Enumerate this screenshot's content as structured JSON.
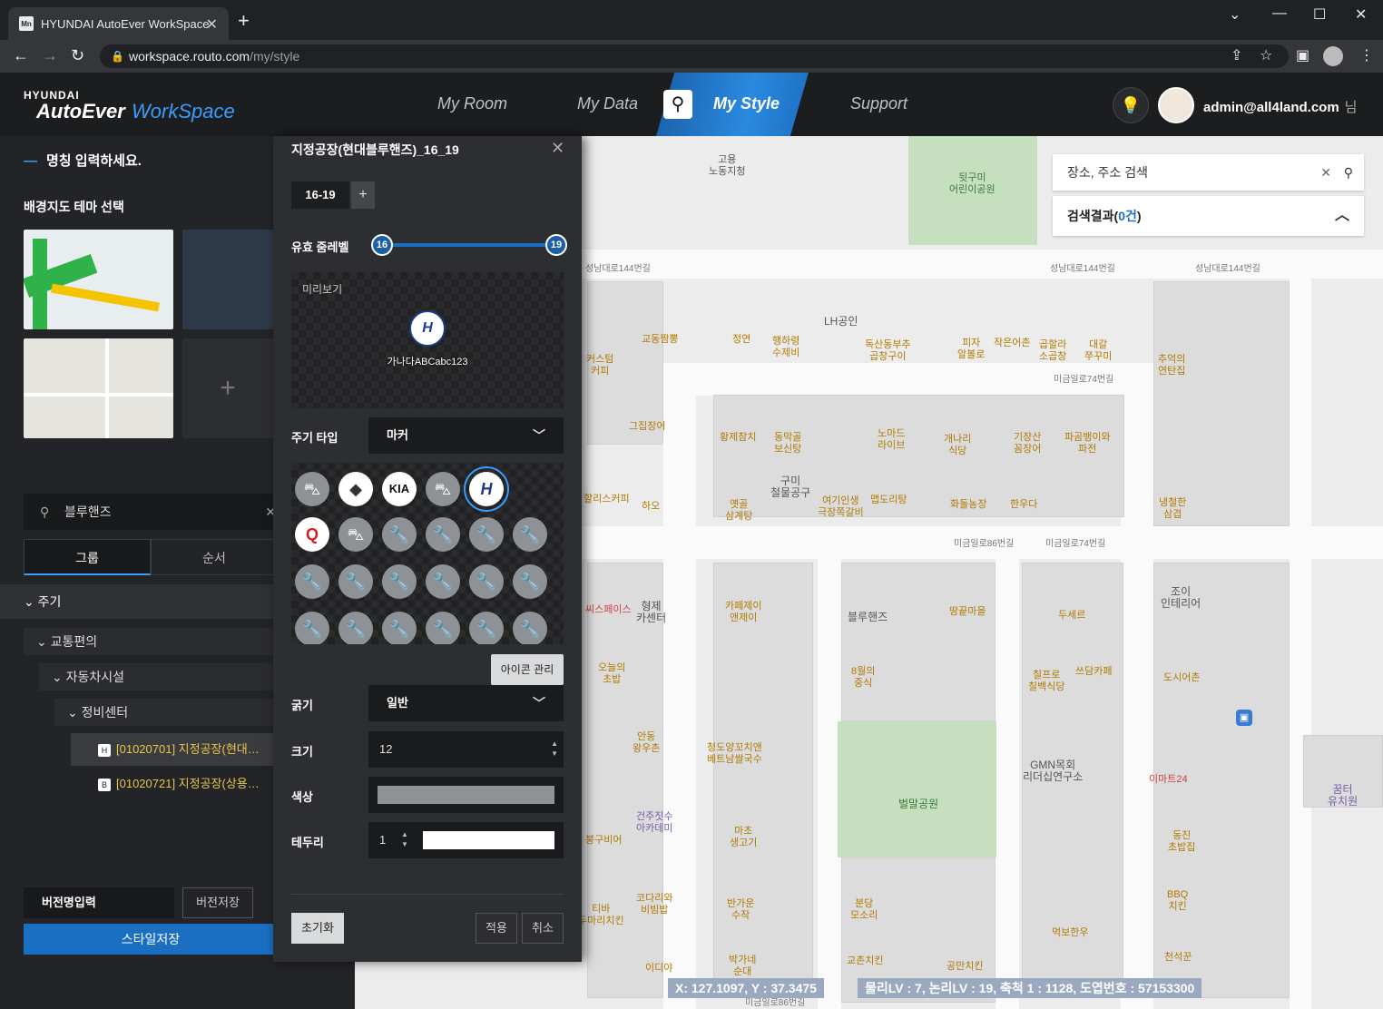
{
  "browser": {
    "tab_title": "HYUNDAI AutoEver WorkSpace",
    "favicon": "Mn",
    "url_host": "workspace.routo.com",
    "url_path": "/my/style"
  },
  "app": {
    "logo_top": "HYUNDAI",
    "logo_main": "AutoEver",
    "logo_sub": "WorkSpace",
    "menu": [
      "My Room",
      "My Data",
      "My Style",
      "Support"
    ],
    "active_menu": "My Style",
    "user": "admin@all4land.com",
    "user_suffix": "님"
  },
  "left": {
    "name_placeholder": "명칭 입력하세요.",
    "theme_title": "배경지도 테마 선택",
    "search_value": "블루핸즈",
    "tab_group": "그룹",
    "tab_order": "순서",
    "tree_root": "주기",
    "tree": [
      {
        "label": "교통편의"
      },
      {
        "label": "자동차시설"
      },
      {
        "label": "정비센터"
      }
    ],
    "tree_items": [
      "[01020701] 지정공장(현대…",
      "[01020721] 지정공장(상용…"
    ],
    "version_input": "버전명입력",
    "version_save": "버전저장",
    "style_save": "스타일저장"
  },
  "popup": {
    "title": "지정공장(현대블루핸즈)_16_19",
    "tab": "16-19",
    "zoom_label": "유효 줌레벨",
    "zoom_min": "16",
    "zoom_max": "19",
    "preview_label": "미리보기",
    "preview_text": "가나다ABCabc123",
    "type_label": "주기 타입",
    "type_value": "마커",
    "icon_manage": "아이콘 관리",
    "weight_label": "굵기",
    "weight_value": "일반",
    "size_label": "크기",
    "size_value": "12",
    "color_label": "색상",
    "color_value": "#8e9196",
    "border_label": "테두리",
    "border_value": "1",
    "reset": "초기화",
    "apply": "적용",
    "cancel": "취소"
  },
  "map": {
    "search_placeholder": "장소, 주소 검색",
    "result_prefix": "검색결과(",
    "result_count": "0건",
    "result_suffix": ")",
    "labels": {
      "l1": "고용\n노동지청",
      "l2": "뒷구미\n어린이공원",
      "l3": "LH공인",
      "l4": "교동짬뽕",
      "l5": "정연",
      "l6": "행하령\n수제비",
      "l7": "독산동부추\n곱창구이",
      "l8": "피자\n알볼로",
      "l9": "작은어촌",
      "l10": "곱할라\n소곱창",
      "l11": "대갈\n쭈꾸미",
      "l12": "추억의\n연탄집",
      "l13": "커스텀\n커피",
      "l14": "그집장어",
      "l15": "황제참치",
      "l16": "동막골\n보신탕",
      "l17": "노마드\n라이브",
      "l18": "개나리\n식당",
      "l19": "기장산\n꼼장어",
      "l20": "파곰뱅이와\n파전",
      "l21": "할리스커피",
      "l22": "하오",
      "l23": "옛골\n삼계탕",
      "l24": "구미\n철물공구",
      "l25": "여기인생\n극장쪽갈비",
      "l26": "맵도리탕",
      "l27": "화돌농장",
      "l28": "한우다",
      "l29": "냉철한\n삼겹",
      "l30": "씨스페이스",
      "l31": "형제\n카센터",
      "l32": "카페제이\n앤제이",
      "l33": "블루핸즈",
      "l34": "땅끝마을",
      "l35": "두세르",
      "l36": "조이\n인테리어",
      "l37": "오늘의\n초밥",
      "l38": "8월의\n중식",
      "l39": "칠프로\n칠백식당",
      "l40": "쓰담카페",
      "l41": "도시어촌",
      "l42": "안동\n왕우촌",
      "l43": "청도양꼬치앤\n베트남쌀국수",
      "l44": "GMN목회\n리더십연구소",
      "l45": "이마트24",
      "l46": "벌말공원",
      "l47": "붕구비어",
      "l48": "건주짓수\n아카데미",
      "l49": "마초\n생고기",
      "l50": "동진\n초밥집",
      "l51": "꿈터\n유치원",
      "l52": "티바\n두마리치킨",
      "l53": "코다리와\n비빔밥",
      "l54": "반가운\n수작",
      "l55": "분당\n모소리",
      "l56": "BBQ\n치킨",
      "l57": "먹보한우",
      "l58": "천석꾼",
      "l59": "박가네\n순대",
      "l60": "교촌치킨",
      "l61": "공만치킨",
      "l62": "이디야"
    },
    "roads": {
      "r1": "성남대로144번길",
      "r2": "성남대로144번길",
      "r3": "성남대로144번길",
      "r4": "미금일로74번길",
      "r5": "미금일로86번길",
      "r6": "미금일로74번길",
      "r7": "미금일로86번길"
    },
    "coord_xy": "X: 127.1097, Y : 37.3475",
    "coord_lv": "물리LV : 7, 논리LV : 19, 축척 1 : 1128, 도엽번호 : 57153300"
  }
}
